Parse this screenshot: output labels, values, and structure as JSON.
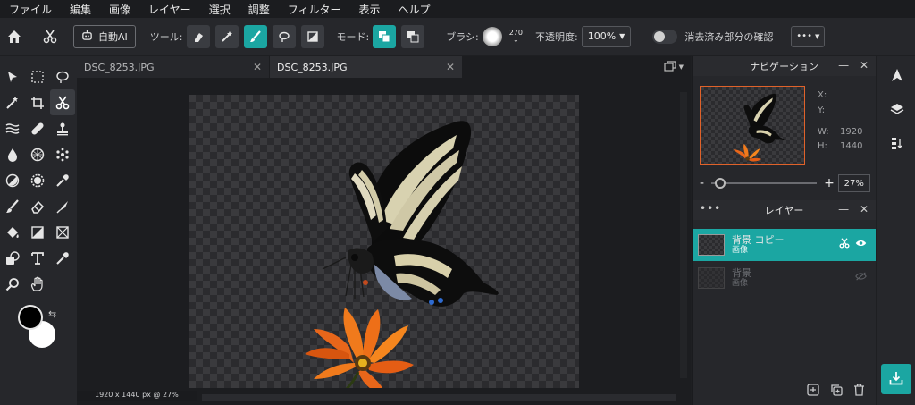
{
  "menu": [
    "ファイル",
    "編集",
    "画像",
    "レイヤー",
    "選択",
    "調整",
    "フィルター",
    "表示",
    "ヘルプ"
  ],
  "toolbar": {
    "auto_ai": "自動AI",
    "tool_label": "ツール:",
    "mode_label": "モード:",
    "brush_label": "ブラシ:",
    "brush_size": "270",
    "opacity_label": "不透明度:",
    "opacity_value": "100%",
    "check_erased_label": "消去済み部分の確認",
    "more": "•••"
  },
  "tabs": [
    {
      "name": "DSC_8253.JPG",
      "active": false
    },
    {
      "name": "DSC_8253.JPG",
      "active": true
    }
  ],
  "status_text": "1920 x 1440 px @ 27%",
  "navigation": {
    "title": "ナビゲーション",
    "x_label": "X:",
    "y_label": "Y:",
    "w_label": "W:",
    "w_value": "1920",
    "h_label": "H:",
    "h_value": "1440",
    "zoom_value": "27%",
    "zoom_level": 0.27
  },
  "layers": {
    "title": "レイヤー",
    "items": [
      {
        "name": "背景 コピー",
        "type": "画像",
        "active": true
      },
      {
        "name": "背景",
        "type": "画像",
        "active": false
      }
    ]
  },
  "colors": {
    "accent": "#1ba6a2",
    "foreground": "#000000",
    "background": "#ffffff"
  }
}
